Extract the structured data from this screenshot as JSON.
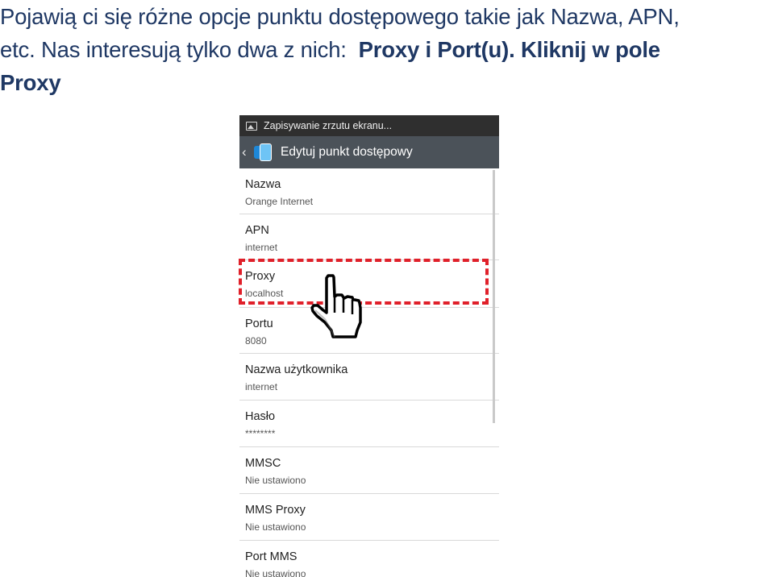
{
  "instruction": {
    "line1": "Pojawią ci się różne opcje punktu dostępowego takie jak Nazwa, APN,",
    "line2_plain": "etc. Nas interesują tylko dwa z nich:  ",
    "line2_bold": "Proxy i Port(u). Kliknij w pole",
    "line3_bold": "Proxy"
  },
  "phone": {
    "statusbar": {
      "icon": "image-icon",
      "text": "Zapisywanie zrzutu ekranu..."
    },
    "actionbar": {
      "back_icon": "chevron-left-icon",
      "app_icon": "settings-app-icon",
      "title": "Edytuj punkt dostępowy"
    },
    "items": [
      {
        "title": "Nazwa",
        "value": "Orange Internet"
      },
      {
        "title": "APN",
        "value": "internet"
      },
      {
        "title": "Proxy",
        "value": "localhost"
      },
      {
        "title": "Portu",
        "value": "8080"
      },
      {
        "title": "Nazwa użytkownika",
        "value": "internet"
      },
      {
        "title": "Hasło",
        "value": "********"
      },
      {
        "title": "MMSC",
        "value": "Nie ustawiono"
      },
      {
        "title": "MMS Proxy",
        "value": "Nie ustawiono"
      },
      {
        "title": "Port MMS",
        "value": "Nie ustawiono"
      }
    ]
  },
  "annotation": {
    "highlight_color": "#e0202a",
    "pointer": "hand-pointer-icon"
  }
}
